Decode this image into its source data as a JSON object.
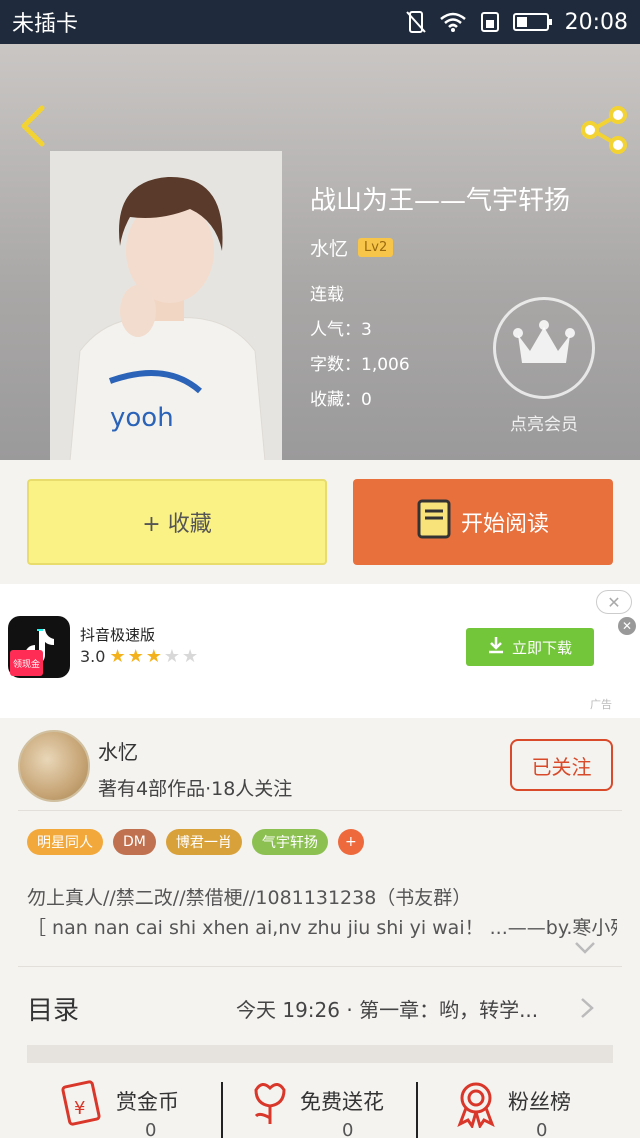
{
  "status_bar": {
    "carrier": "未插卡",
    "time": "20:08"
  },
  "book": {
    "title": "战山为王——气宇轩扬",
    "author": "水忆",
    "level": "Lv2",
    "status": "连载",
    "popularity": "人气：3",
    "words": "字数：1,006",
    "favorites": "收藏：0",
    "vip_label": "点亮会员"
  },
  "actions": {
    "favorite": "+ 收藏",
    "read": "开始阅读"
  },
  "ad": {
    "app_name": "抖音极速版",
    "rating": "3.0",
    "badge": "领现金",
    "download": "立即下载",
    "ad_label": "广告"
  },
  "author_card": {
    "name": "水忆",
    "stats": "著有4部作品·18人关注",
    "follow": "已关注"
  },
  "tags": [
    {
      "label": "明星同人",
      "color": "#f2a83a"
    },
    {
      "label": "DM",
      "color": "#c0714f"
    },
    {
      "label": "博君一肖",
      "color": "#d9a13a"
    },
    {
      "label": "气宇轩扬",
      "color": "#8cc152"
    },
    {
      "label": "+",
      "color": "#ee6a3c"
    }
  ],
  "intro": {
    "line1": "勿上真人//禁二改//禁借梗//1081131238（书友群）",
    "line2": "［ nan nan cai shi xhen ai,nv zhu jiu shi yi wai！ ...——by.寒小殇"
  },
  "toc": {
    "label": "目录",
    "latest": "今天 19:26 · 第一章：哟，转学..."
  },
  "bottom": {
    "reward": {
      "label": "赏金币",
      "count": "0"
    },
    "flower": {
      "label": "免费送花",
      "count": "0"
    },
    "fans": {
      "label": "粉丝榜",
      "count": "0"
    }
  }
}
